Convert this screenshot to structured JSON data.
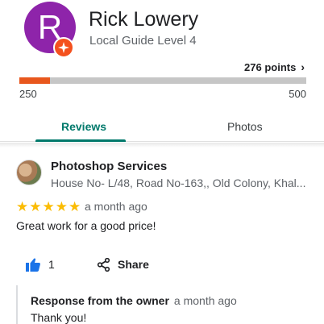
{
  "profile": {
    "initial": "R",
    "name": "Rick Lowery",
    "level": "Local Guide Level 4",
    "points": "276 points",
    "progress_fraction": 0.106,
    "progress_min": "250",
    "progress_max": "500",
    "avatar_color": "#8e24aa",
    "progress_color": "#e8571d"
  },
  "tabs": [
    {
      "label": "Reviews",
      "active": true
    },
    {
      "label": "Photos",
      "active": false
    }
  ],
  "review": {
    "place_name": "Photoshop Services",
    "place_address": "House No- L/48, Road No-163,, Old Colony, Khal...",
    "rating": 5,
    "stars": "★★★★★",
    "date": "a month ago",
    "text": "Great work for a good price!",
    "like_count": "1",
    "share_label": "Share",
    "response_title": "Response from the owner",
    "response_date": "a month ago",
    "response_text": "Thank you!"
  },
  "colors": {
    "accent": "#00796b",
    "star": "#fbbc04"
  }
}
